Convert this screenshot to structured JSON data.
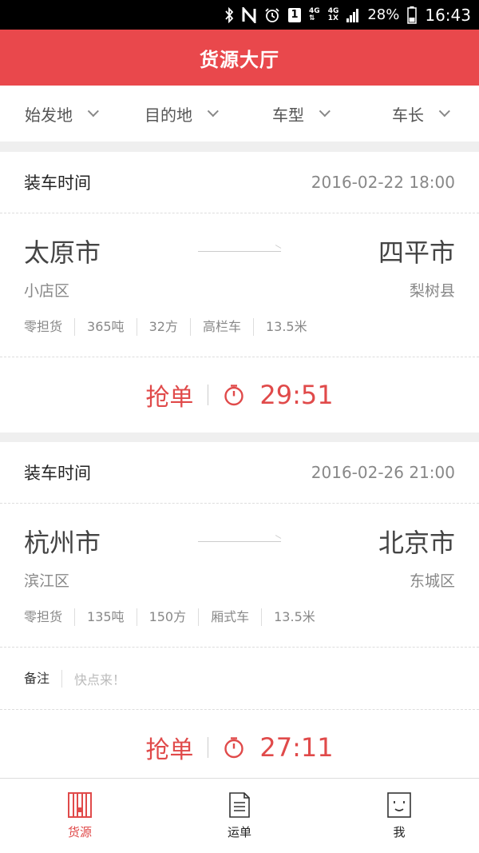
{
  "status_bar": {
    "icons": [
      "bluetooth-icon",
      "nfc-icon",
      "alarm-icon",
      "sim-icon",
      "signal-icon",
      "battery-icon"
    ],
    "sim_label": "1",
    "network_top": "4G",
    "network_bottom": "1X",
    "network_top2": "4G",
    "battery": "28%",
    "time": "16:43"
  },
  "header": {
    "title": "货源大厅"
  },
  "filters": [
    {
      "label": "始发地"
    },
    {
      "label": "目的地"
    },
    {
      "label": "车型"
    },
    {
      "label": "车长"
    }
  ],
  "cards": [
    {
      "load_label": "装车时间",
      "load_time": "2016-02-22 18:00",
      "origin_city": "太原市",
      "origin_district": "小店区",
      "dest_city": "四平市",
      "dest_district": "梨树县",
      "specs": [
        "零担货",
        "365吨",
        "32方",
        "高栏车",
        "13.5米"
      ],
      "grab_label": "抢单",
      "countdown": "29:51"
    },
    {
      "load_label": "装车时间",
      "load_time": "2016-02-26 21:00",
      "origin_city": "杭州市",
      "origin_district": "滨江区",
      "dest_city": "北京市",
      "dest_district": "东城区",
      "specs": [
        "零担货",
        "135吨",
        "150方",
        "厢式车",
        "13.5米"
      ],
      "remark_label": "备注",
      "remark_text": "快点来！",
      "grab_label": "抢单",
      "countdown": "27:11"
    }
  ],
  "tabs": [
    {
      "label": "货源",
      "icon": "cargo-icon",
      "active": true
    },
    {
      "label": "运单",
      "icon": "waybill-icon",
      "active": false
    },
    {
      "label": "我",
      "icon": "profile-face-icon",
      "active": false
    }
  ],
  "colors": {
    "accent": "#e9484c",
    "countdown": "#e04a4a"
  }
}
